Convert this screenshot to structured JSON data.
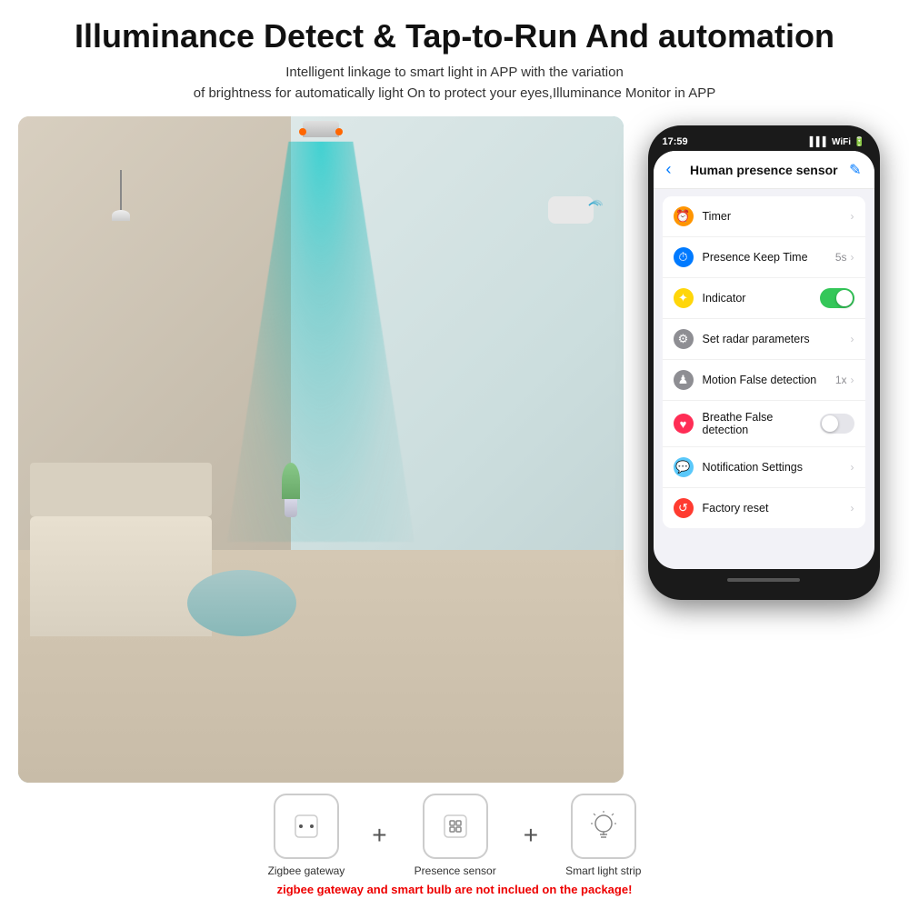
{
  "header": {
    "title": "Illuminance Detect & Tap-to-Run And automation",
    "subtitle_line1": "Intelligent linkage to smart light in APP with the variation",
    "subtitle_line2": "of brightness for automatically light On to protect your eyes,Illuminance Monitor in APP"
  },
  "phone": {
    "status_time": "17:59",
    "status_signal": "4",
    "app_title": "Human presence sensor",
    "menu_items": [
      {
        "icon": "⏰",
        "icon_class": "icon-orange",
        "label": "Timer",
        "value": "",
        "type": "chevron"
      },
      {
        "icon": "⏱",
        "icon_class": "icon-blue",
        "label": "Presence Keep Time",
        "value": "5s",
        "type": "chevron"
      },
      {
        "icon": "✦",
        "icon_class": "icon-yellow",
        "label": "Indicator",
        "value": "",
        "type": "toggle-on"
      },
      {
        "icon": "⚙",
        "icon_class": "icon-gray",
        "label": "Set radar parameters",
        "value": "",
        "type": "chevron"
      },
      {
        "icon": "♟",
        "icon_class": "icon-gray",
        "label": "Motion False detection",
        "value": "1x",
        "type": "chevron"
      },
      {
        "icon": "♥",
        "icon_class": "icon-pink",
        "label": "Breathe False detection",
        "value": "",
        "type": "toggle-off"
      },
      {
        "icon": "💬",
        "icon_class": "icon-teal",
        "label": "Notification Settings",
        "value": "",
        "type": "chevron"
      },
      {
        "icon": "↺",
        "icon_class": "icon-red",
        "label": "Factory reset",
        "value": "",
        "type": "chevron"
      }
    ]
  },
  "bottom": {
    "devices": [
      {
        "icon": "⬜",
        "label": "Zigbee gateway",
        "icon_type": "gateway"
      },
      {
        "icon": "📡",
        "label": "Presence sensor",
        "icon_type": "sensor"
      },
      {
        "icon": "💡",
        "label": "Smart light strip",
        "icon_type": "light"
      }
    ],
    "disclaimer": "zigbee gateway and smart bulb are not inclued on the package!"
  },
  "icons": {
    "back": "‹",
    "edit": "✎",
    "chevron": "›",
    "plus": "+"
  }
}
